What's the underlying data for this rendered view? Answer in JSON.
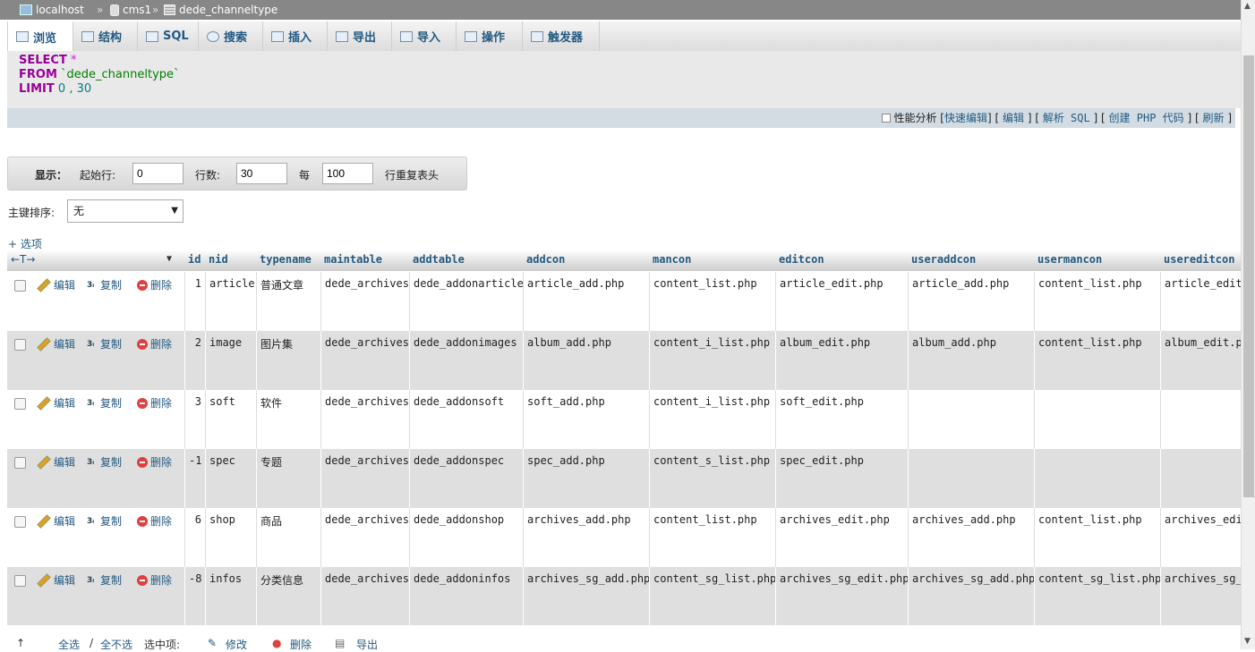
{
  "breadcrumb": {
    "server": "localhost",
    "database": "cms1",
    "table": "dede_channeltype",
    "separator": "»"
  },
  "tabs": [
    {
      "label": "浏览",
      "icon": "browse-icon"
    },
    {
      "label": "结构",
      "icon": "structure-icon"
    },
    {
      "label": "SQL",
      "icon": "sql-icon"
    },
    {
      "label": "搜索",
      "icon": "search-icon"
    },
    {
      "label": "插入",
      "icon": "insert-icon"
    },
    {
      "label": "导出",
      "icon": "export-icon"
    },
    {
      "label": "导入",
      "icon": "import-icon"
    },
    {
      "label": "操作",
      "icon": "wrench-icon"
    },
    {
      "label": "触发器",
      "icon": "trigger-icon"
    }
  ],
  "sql": {
    "select_kw": "SELECT",
    "star": "*",
    "from_kw": "FROM",
    "table": "`dede_channeltype`",
    "limit_kw": "LIMIT",
    "offset": "0",
    "comma": ",",
    "count": "30"
  },
  "sql_links": {
    "profiling": "性能分析",
    "quick_edit": "快速编辑",
    "edit": "编辑",
    "explain": "解析 SQL",
    "create_php": "创建 PHP 代码",
    "refresh": "刷新"
  },
  "nav": {
    "show_label": "显示：",
    "start_label": "起始行:",
    "start_value": "0",
    "rows_label": "行数:",
    "rows_value": "30",
    "every_label": "每",
    "repeat_value": "100",
    "repeat_label": "行重复表头"
  },
  "sort": {
    "label": "主键排序:",
    "value": "无"
  },
  "options_link": "+ 选项",
  "table_header": {
    "arrows": "←T→",
    "columns": [
      "id",
      "nid",
      "typename",
      "maintable",
      "addtable",
      "addcon",
      "mancon",
      "editcon",
      "useraddcon",
      "usermancon",
      "usereditcon"
    ]
  },
  "row_actions": {
    "edit": "编辑",
    "copy": "复制",
    "delete": "删除"
  },
  "rows": [
    [
      "1",
      "article",
      "普通文章",
      "dede_archives",
      "dede_addonarticle",
      "article_add.php",
      "content_list.php",
      "article_edit.php",
      "article_add.php",
      "content_list.php",
      "article_edit.php"
    ],
    [
      "2",
      "image",
      "图片集",
      "dede_archives",
      "dede_addonimages",
      "album_add.php",
      "content_i_list.php",
      "album_edit.php",
      "album_add.php",
      "content_list.php",
      "album_edit.php"
    ],
    [
      "3",
      "soft",
      "软件",
      "dede_archives",
      "dede_addonsoft",
      "soft_add.php",
      "content_i_list.php",
      "soft_edit.php",
      "",
      "",
      ""
    ],
    [
      "-1",
      "spec",
      "专题",
      "dede_archives",
      "dede_addonspec",
      "spec_add.php",
      "content_s_list.php",
      "spec_edit.php",
      "",
      "",
      ""
    ],
    [
      "6",
      "shop",
      "商品",
      "dede_archives",
      "dede_addonshop",
      "archives_add.php",
      "content_list.php",
      "archives_edit.php",
      "archives_add.php",
      "content_list.php",
      "archives_edit.php"
    ],
    [
      "-8",
      "infos",
      "分类信息",
      "dede_archives",
      "dede_addoninfos",
      "archives_sg_add.php",
      "content_sg_list.php",
      "archives_sg_edit.php",
      "archives_sg_add.php",
      "content_sg_list.php",
      "archives_sg_edit.php"
    ]
  ],
  "bottom": {
    "check_all": "全选",
    "slash": "/",
    "uncheck_all": "全不选",
    "with_selected": "选中项:",
    "change": "修改",
    "delete": "删除",
    "export": "导出"
  }
}
